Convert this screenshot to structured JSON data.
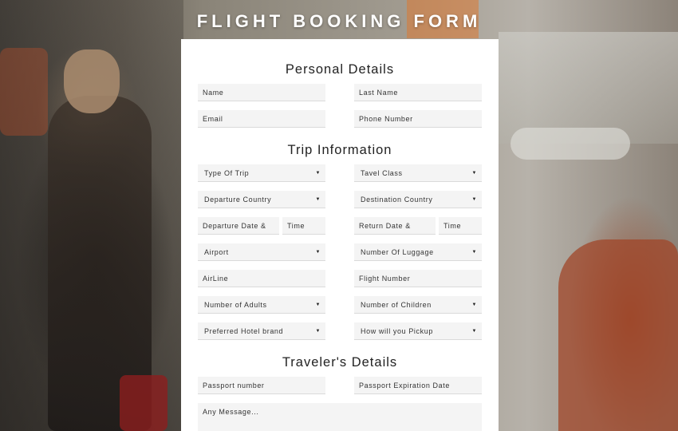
{
  "page_title": "FLIGHT BOOKING FORM",
  "sections": {
    "personal": {
      "title": "Personal Details",
      "name": "Name",
      "last_name": "Last Name",
      "email": "Email",
      "phone": "Phone Number"
    },
    "trip": {
      "title": "Trip Information",
      "trip_type": "Type Of Trip",
      "travel_class": "Tavel Class",
      "departure_country": "Departure Country",
      "destination_country": "Destination Country",
      "departure_date": "Departure Date &",
      "departure_time": "Time",
      "return_date": "Return Date &",
      "return_time": "Time",
      "airport": "Airport",
      "luggage": "Number Of Luggage",
      "airline": "AirLine",
      "flight_number": "Flight Number",
      "adults": "Number of Adults",
      "children": "Number of Children",
      "hotel": "Preferred Hotel brand",
      "pickup": "How will you Pickup"
    },
    "traveler": {
      "title": "Traveler's Details",
      "passport": "Passport number",
      "passport_expiry": "Passport Expiration Date",
      "message": "Any Message..."
    }
  },
  "icons": {
    "dropdown": "caret-down-icon"
  },
  "caret_glyph": "▼"
}
